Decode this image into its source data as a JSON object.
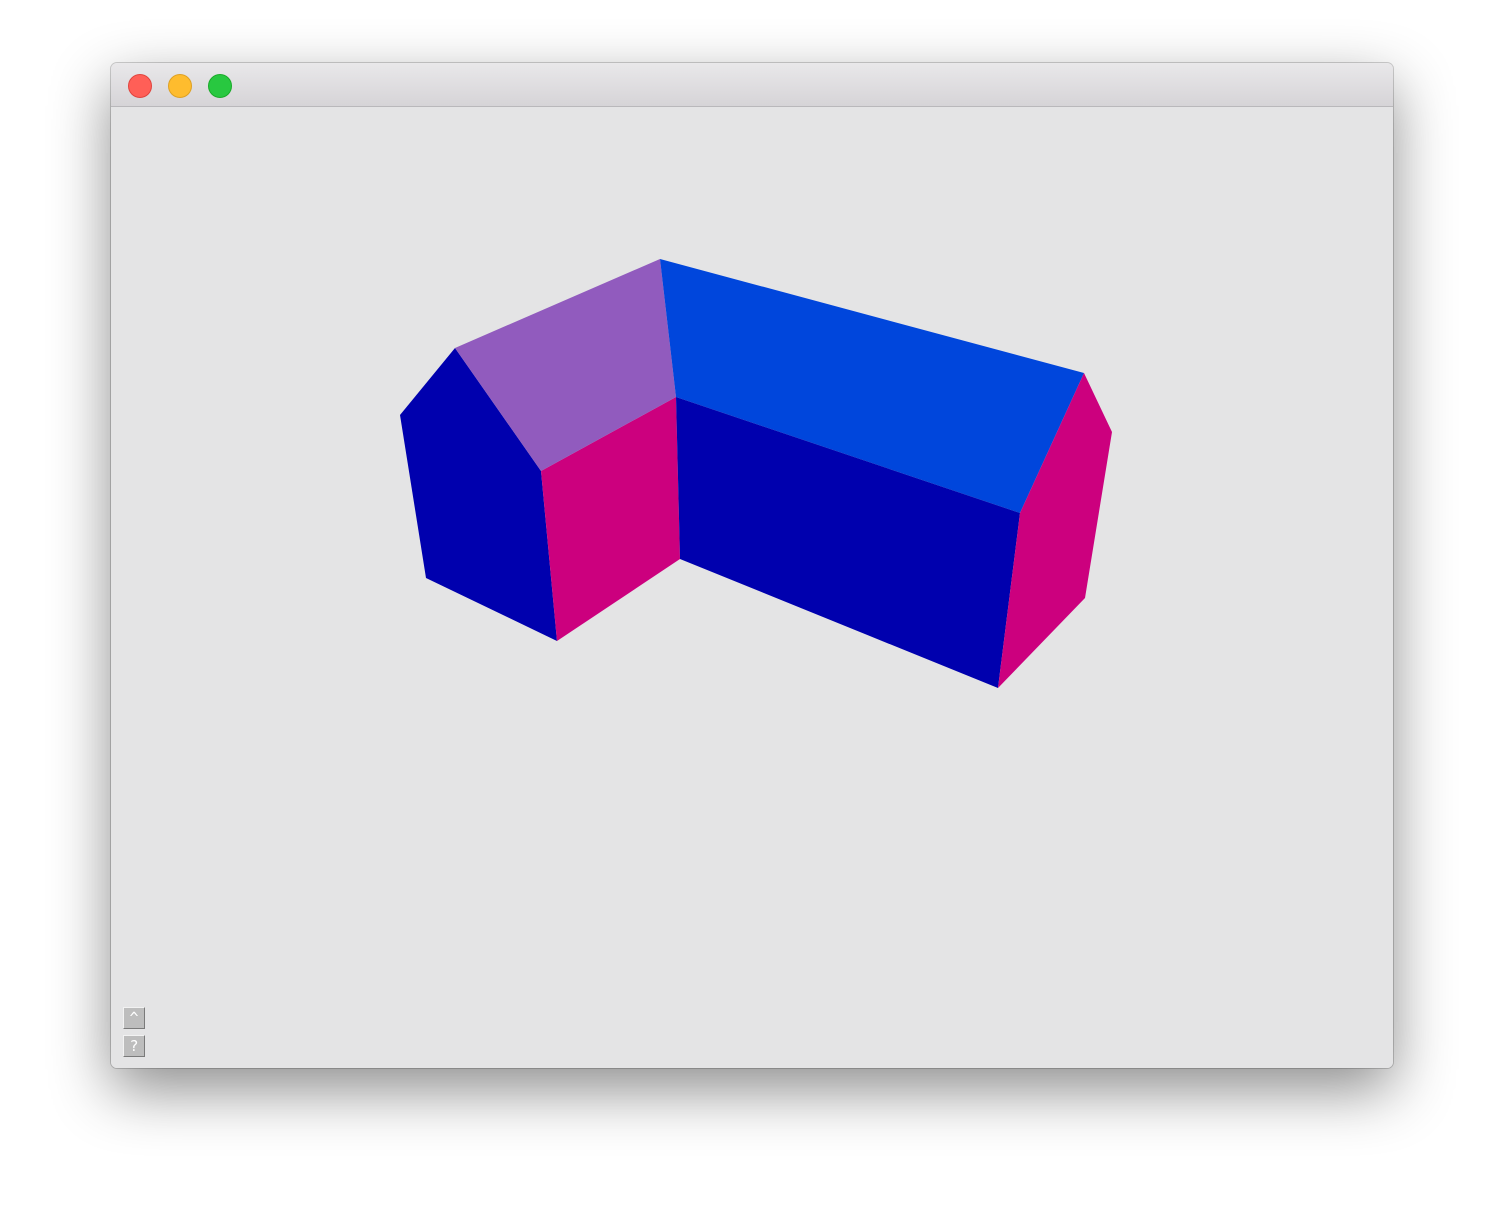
{
  "window": {
    "title": "",
    "traffic_lights": {
      "close_color": "#ff5f57",
      "minimize_color": "#febc2e",
      "zoom_color": "#28c840"
    }
  },
  "scene": {
    "background": "#e4e4e5",
    "colors": {
      "roof_purple": "#915bbe",
      "roof_blue": "#0046dc",
      "wall_navy": "#0000ae",
      "wall_magenta": "#cc007e"
    }
  },
  "controls": {
    "up_label": "^",
    "help_label": "?"
  }
}
